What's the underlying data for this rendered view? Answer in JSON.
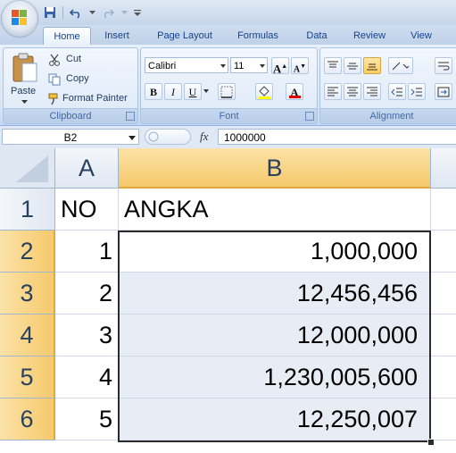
{
  "quick_access": {
    "undo_label": "",
    "redo_label": ""
  },
  "tabs": [
    {
      "label": "Home",
      "active": true
    },
    {
      "label": "Insert",
      "active": false
    },
    {
      "label": "Page Layout",
      "active": false
    },
    {
      "label": "Formulas",
      "active": false
    },
    {
      "label": "Data",
      "active": false
    },
    {
      "label": "Review",
      "active": false
    },
    {
      "label": "View",
      "active": false
    }
  ],
  "clipboard": {
    "paste_label": "Paste",
    "cut_label": "Cut",
    "copy_label": "Copy",
    "format_painter_label": "Format Painter",
    "group_label": "Clipboard"
  },
  "font": {
    "font_name": "Calibri",
    "font_size": "11",
    "bold_label": "B",
    "italic_label": "I",
    "underline_label": "U",
    "grow_label": "A",
    "shrink_label": "A",
    "font_color_label": "A",
    "group_label": "Font"
  },
  "alignment": {
    "group_label": "Alignment"
  },
  "formula_bar": {
    "name_box": "B2",
    "fx_label": "fx",
    "formula": "1000000"
  },
  "sheet": {
    "column_headers": [
      "A",
      "B"
    ],
    "row_headers": [
      "1",
      "2",
      "3",
      "4",
      "5",
      "6"
    ],
    "rows": [
      {
        "a": "NO",
        "b": "ANGKA"
      },
      {
        "a": "1",
        "b": "1,000,000"
      },
      {
        "a": "2",
        "b": "12,456,456"
      },
      {
        "a": "3",
        "b": "12,000,000"
      },
      {
        "a": "4",
        "b": "1,230,005,600"
      },
      {
        "a": "5",
        "b": "12,250,007"
      }
    ],
    "active_cell": "B2"
  },
  "colors": {
    "selection_header": "#f6c96c",
    "ribbon": "#d9e6f6",
    "header_text": "#27415f"
  }
}
